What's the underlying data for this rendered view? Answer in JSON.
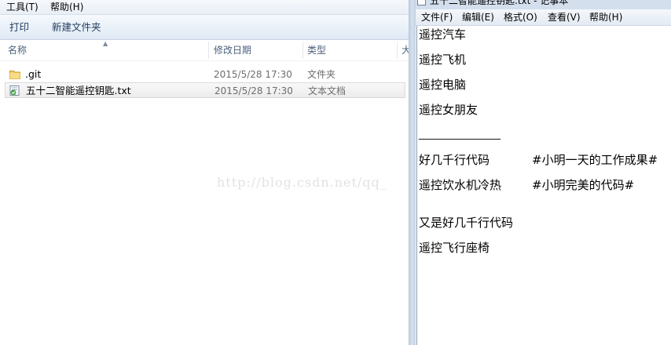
{
  "explorer": {
    "menu": [
      "工具(T)",
      "帮助(H)"
    ],
    "toolbar": {
      "print": "打印",
      "new_folder": "新建文件夹"
    },
    "columns": {
      "name": "名称",
      "modified": "修改日期",
      "type": "类型",
      "size": "大"
    },
    "files": [
      {
        "name": ".git",
        "modified": "2015/5/28 17:30",
        "type": "文件夹",
        "icon": "folder-icon"
      },
      {
        "name": "五十二智能遥控钥匙.txt",
        "modified": "2015/5/28 17:30",
        "type": "文本文档",
        "icon": "text-file-icon",
        "selected": true
      }
    ],
    "watermark": "http://blog.csdn.net/qq_"
  },
  "notepad": {
    "title": "五十二智能遥控钥匙.txt - 记事本",
    "menu": [
      "文件(F)",
      "编辑(E)",
      "格式(O)",
      "查看(V)",
      "帮助(H)"
    ],
    "lines": [
      "遥控汽车",
      "遥控飞机",
      "遥控电脑",
      "遥控女朋友",
      "________________",
      "好几千行代码",
      "遥控饮水机冷热",
      "",
      "又是好几千行代码",
      "遥控飞行座椅"
    ],
    "comments": {
      "line6": "#小明一天的工作成果#",
      "line7": "#小明完美的代码#"
    }
  }
}
